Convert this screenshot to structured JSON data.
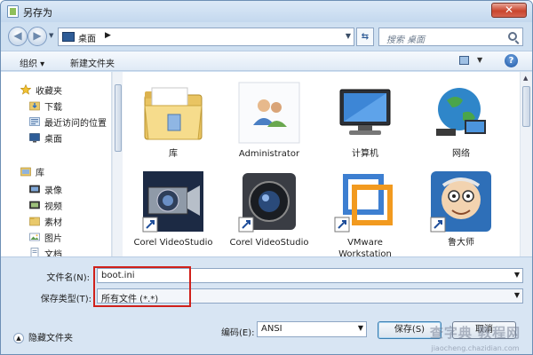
{
  "window": {
    "title": "另存为",
    "close_label": "✕"
  },
  "address": {
    "location": "桌面",
    "arrow": "▶",
    "search_placeholder": "搜索 桌面"
  },
  "toolbar": {
    "organize": "组织 ▾",
    "new_folder": "新建文件夹",
    "help": "?"
  },
  "sidebar": {
    "items": [
      {
        "label": "收藏夹",
        "icon": "star-icon"
      },
      {
        "label": "下载",
        "icon": "download-folder-icon"
      },
      {
        "label": "最近访问的位置",
        "icon": "recent-places-icon"
      },
      {
        "label": "桌面",
        "icon": "desktop-icon"
      },
      {
        "label": "库",
        "icon": "library-icon"
      },
      {
        "label": "录像",
        "icon": "video-library-icon"
      },
      {
        "label": "视频",
        "icon": "videos-icon"
      },
      {
        "label": "素材",
        "icon": "materials-folder-icon"
      },
      {
        "label": "图片",
        "icon": "pictures-icon"
      },
      {
        "label": "文档",
        "icon": "documents-icon"
      }
    ]
  },
  "files": [
    {
      "name": "库",
      "icon": "library-folder-icon"
    },
    {
      "name": "Administrator",
      "icon": "user-folder-icon"
    },
    {
      "name": "计算机",
      "icon": "computer-icon"
    },
    {
      "name": "网络",
      "icon": "network-globe-icon"
    },
    {
      "name": "Corel VideoStudio",
      "icon": "corel-camera-icon"
    },
    {
      "name": "Corel VideoStudio",
      "icon": "corel-lens-icon"
    },
    {
      "name": "VMware Workstation",
      "icon": "vmware-icon"
    },
    {
      "name": "鲁大师",
      "icon": "ludashi-icon"
    }
  ],
  "form": {
    "filename_label": "文件名(N):",
    "filename_value": "boot.ini",
    "filetype_label": "保存类型(T):",
    "filetype_value": "所有文件  (*.*)",
    "hide_folders": "隐藏文件夹",
    "encoding_label": "编码(E):",
    "encoding_value": "ANSI",
    "save_button": "保存(S)",
    "cancel_button": "取消"
  },
  "watermark": {
    "main": "查字典 教程网",
    "sub": "jiaocheng.chazidian.com"
  }
}
